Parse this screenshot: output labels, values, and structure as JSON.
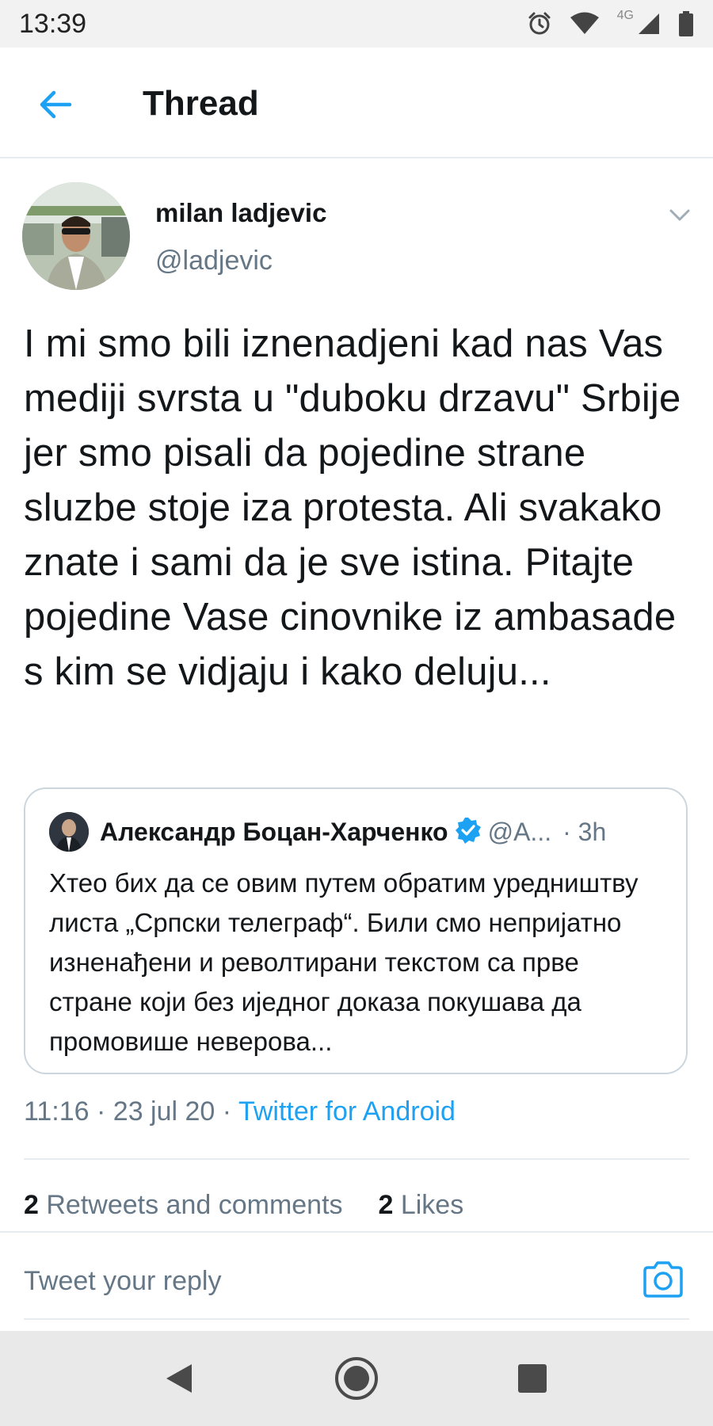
{
  "status_bar": {
    "time": "13:39",
    "network": "4G",
    "icons": [
      "alarm-icon",
      "wifi-icon",
      "signal-icon",
      "battery-icon"
    ]
  },
  "header": {
    "title": "Thread",
    "back_icon": "arrow-left-icon"
  },
  "tweet": {
    "author_name": "milan ladjevic",
    "author_handle": "@ladjevic",
    "text": "I mi smo bili iznenadjeni kad nas Vas mediji svrsta u \"duboku drzavu\" Srbije jer smo pisali da pojedine strane sluzbe stoje iza protesta. Ali svakako znate i sami da je sve istina. Pitajte pojedine Vase cinovnike iz ambasade s kim se vidjaju i kako deluju...",
    "time": "11:16",
    "date": "23 jul 20",
    "source": "Twitter for Android",
    "retweets_count": "2",
    "retweets_label": "Retweets and comments",
    "likes_count": "2",
    "likes_label": "Likes"
  },
  "quoted_tweet": {
    "author_name": "Александр Боцан-Харченко",
    "author_handle": "@A...",
    "time": "3h",
    "text": "Хтео бих да се овим путем обратим уредништву листа „Српски телеграф“. Били смо непријатно изненађени и револтирани текстом са прве стране који без ијeдног доказа покушава да промовише неверова..."
  },
  "reply": {
    "placeholder": "Tweet your reply"
  },
  "colors": {
    "accent": "#1da1f2",
    "secondary_text": "#657786",
    "primary_text": "#14171a",
    "divider": "#e6ecf0"
  }
}
